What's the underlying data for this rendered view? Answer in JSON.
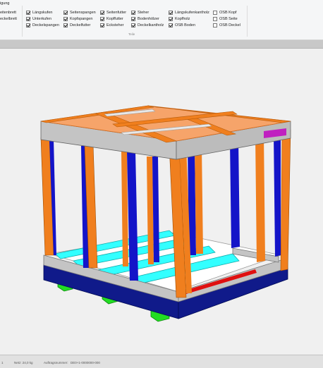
{
  "ribbon": {
    "title": "igung",
    "left_items": [
      "eitenbrett",
      "eckelbrett"
    ],
    "group_label": "Teile",
    "columns": [
      [
        {
          "label": "Längskufen",
          "checked": true
        },
        {
          "label": "Unterkufen",
          "checked": true
        },
        {
          "label": "Deckelspangen",
          "checked": true
        }
      ],
      [
        {
          "label": "Seitenspangen",
          "checked": true
        },
        {
          "label": "Kopfspangen",
          "checked": true
        },
        {
          "label": "Deckelfutter",
          "checked": true
        }
      ],
      [
        {
          "label": "Seitenfutter",
          "checked": true
        },
        {
          "label": "Kopffutter",
          "checked": true
        },
        {
          "label": "Ecksteher",
          "checked": true
        }
      ],
      [
        {
          "label": "Steher",
          "checked": true
        },
        {
          "label": "Bodenhölzer",
          "checked": true
        },
        {
          "label": "Deckelkantholz",
          "checked": true
        }
      ],
      [
        {
          "label": "Längskufenkantholz",
          "checked": true
        },
        {
          "label": "Kopfholz",
          "checked": true
        },
        {
          "label": "OSB Boden",
          "checked": true
        }
      ],
      [
        {
          "label": "OSB Kopf",
          "checked": false
        },
        {
          "label": "OSB Seite",
          "checked": false
        },
        {
          "label": "OSB Deckel",
          "checked": false
        }
      ]
    ]
  },
  "statusbar": {
    "items": [
      "1",
      "Netz: 24,0 kg",
      "Auftragsnummer:",
      "DE0+1-0000000-000"
    ]
  },
  "colors": {
    "orange": "#f07f1e",
    "blue": "#1414c8",
    "navy": "#101a8a",
    "cyan": "#33ffff",
    "green": "#22dd22",
    "grey": "#c4c4c4",
    "red": "#e01010",
    "magenta": "#c020c0",
    "floor": "#ffffff"
  }
}
